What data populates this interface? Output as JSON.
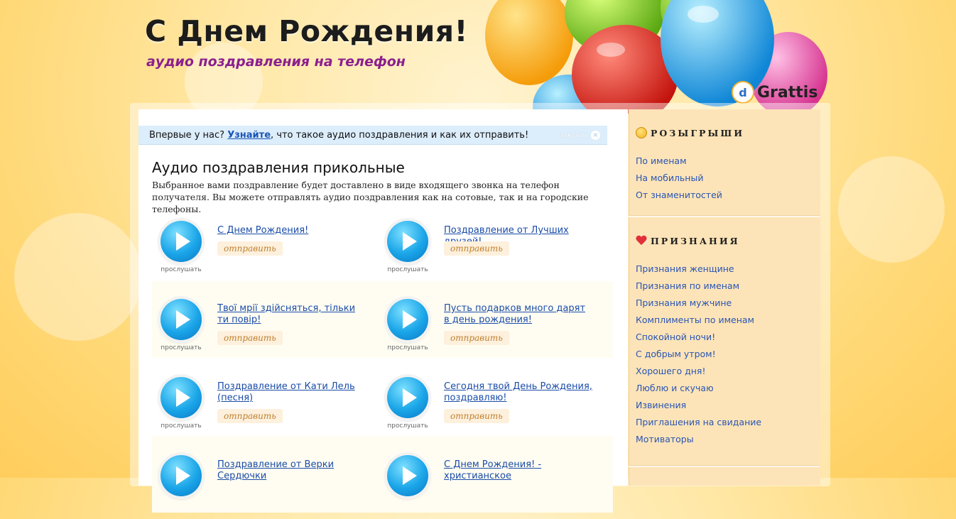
{
  "header": {
    "title": "С Днем Рождения!",
    "subtitle": "аудио поздравления на телефон",
    "brand": "Grattis"
  },
  "notice": {
    "prefix": "Впервые у нас?",
    "link": "Узнайте",
    "suffix": ", что такое аудио поздравления и как их отправить!",
    "close_label": "закрыть"
  },
  "main": {
    "heading": "Аудио поздравления прикольные",
    "description": "Выбранное вами поздравление будет доставлено в виде входящего звонка на телефон получателя. Вы можете отправлять аудио поздравления как на сотовые, так и на городские телефоны.",
    "listen_label": "прослушать",
    "send_label": "отправить",
    "items": [
      {
        "title": "С Днем Рождения!"
      },
      {
        "title": "Поздравление от Лучших друзей!"
      },
      {
        "title": "Твої мрії здійсняться, тільки ти повір!"
      },
      {
        "title": "Пусть подарков много дарят в день рождения!"
      },
      {
        "title": "Поздравление от Кати Лель (песня)"
      },
      {
        "title": "Сегодня твой День Рождения, поздравляю!"
      },
      {
        "title": "Поздравление от Верки Сердючки"
      },
      {
        "title": "С Днем Рождения! - христианское"
      }
    ]
  },
  "sidebar": {
    "sections": [
      {
        "title": "РОЗЫГРЫШИ",
        "icon": "smile-icon",
        "links": [
          "По именам",
          "На мобильный",
          "От знаменитостей"
        ]
      },
      {
        "title": "ПРИЗНАНИЯ",
        "icon": "heart-icon",
        "links": [
          "Признания женщине",
          "Признания по именам",
          "Признания мужчине",
          "Комплименты по именам",
          "Спокойной ночи!",
          "С добрым утром!",
          "Хорошего дня!",
          "Люблю и скучаю",
          "Извинения",
          "Приглашения на свидание",
          "Мотиваторы"
        ]
      }
    ]
  },
  "colors": {
    "link": "#1a4ca8",
    "subtitle": "#8b1f8f",
    "notice_bg": "#dcedfb",
    "sidebar_bg": "#fde4b8",
    "send_text": "#c08030"
  }
}
